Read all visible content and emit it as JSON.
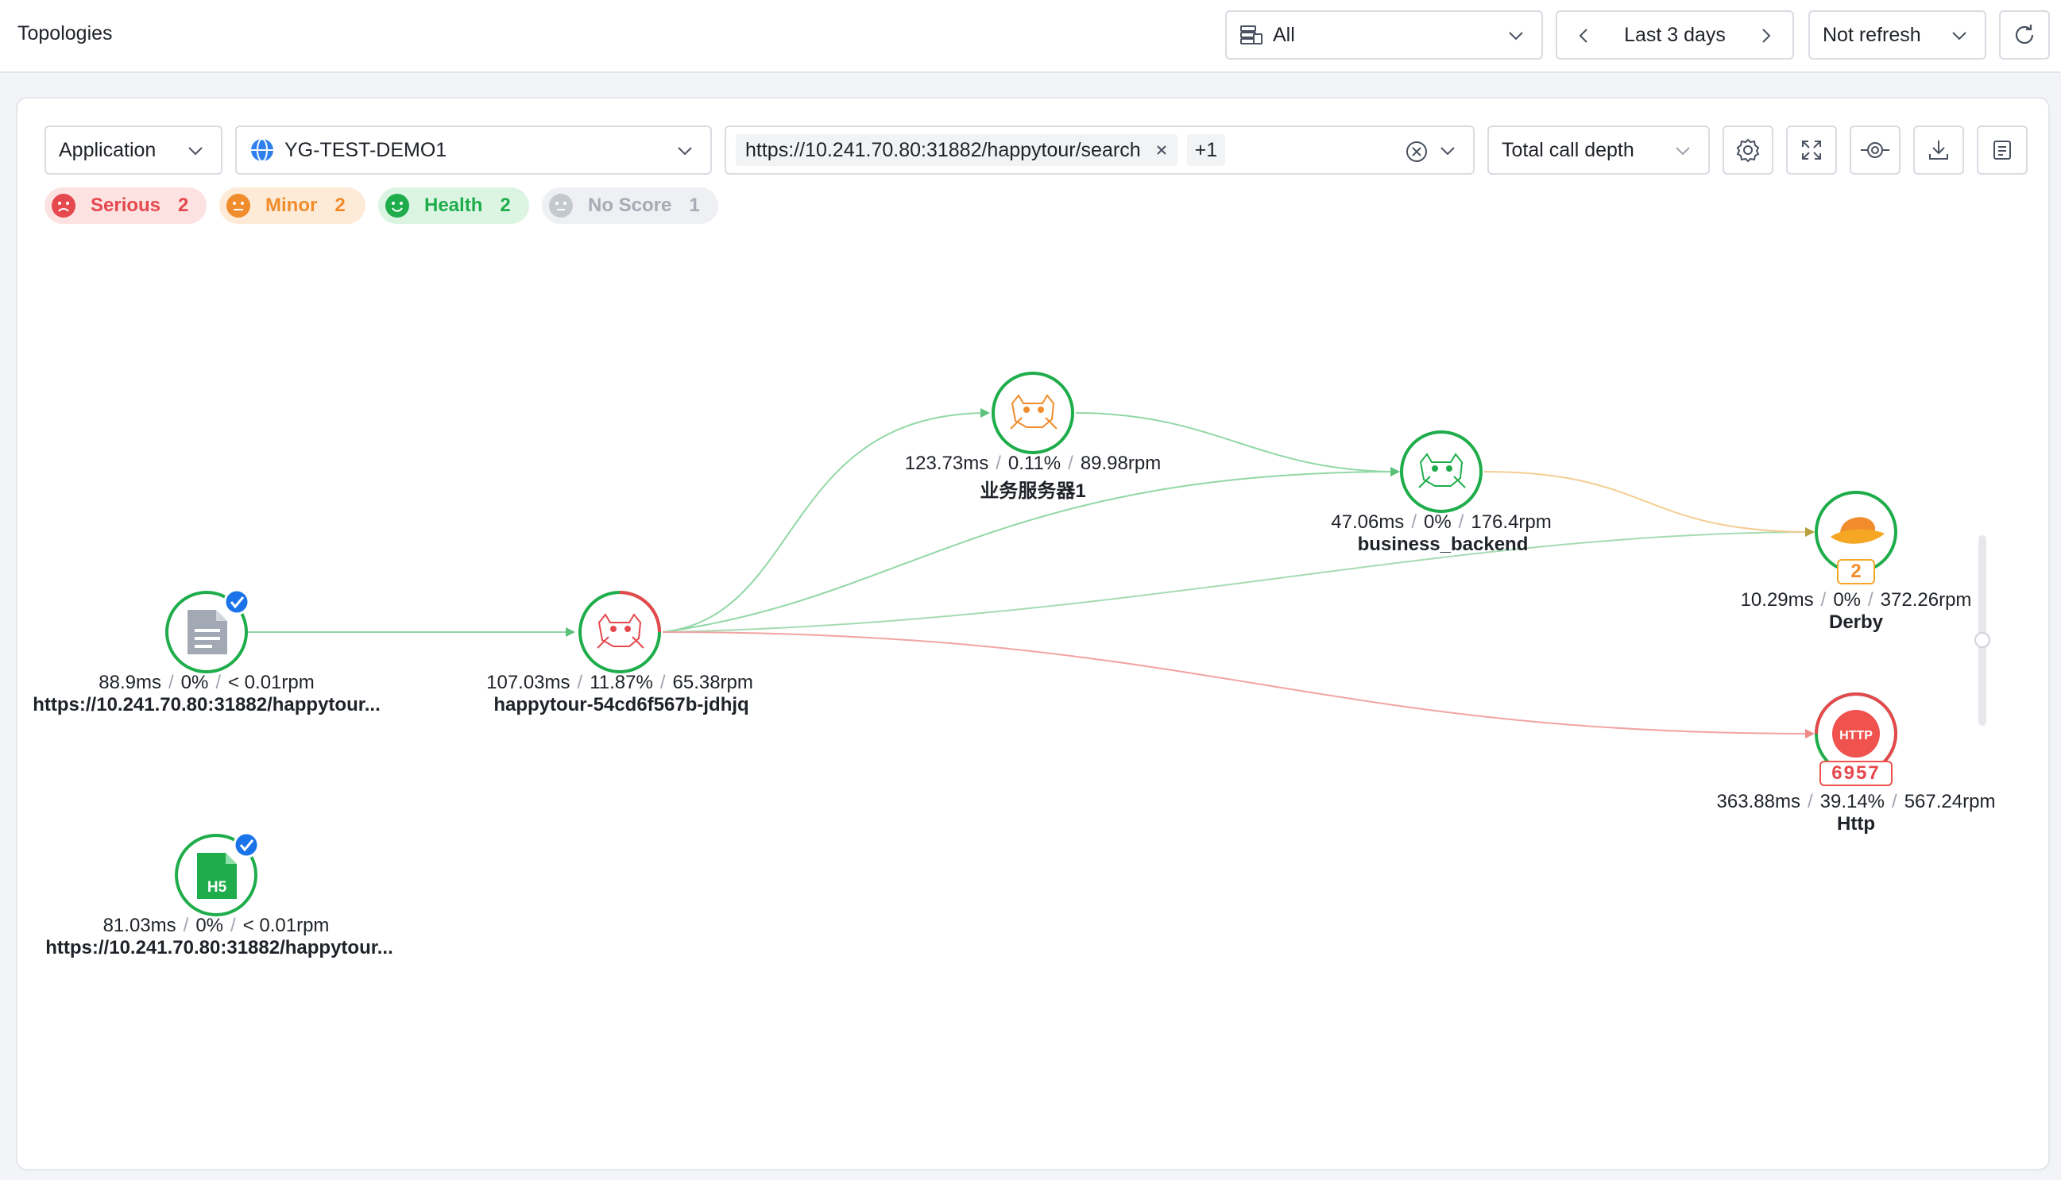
{
  "header": {
    "title": "Topologies",
    "scope_select": {
      "value": "All",
      "icon": "database-list-icon"
    },
    "time_range": {
      "value": "Last 3 days"
    },
    "refresh_select": {
      "value": "Not refresh"
    },
    "reload_icon": "reload-icon"
  },
  "toolbar": {
    "type_select": {
      "value": "Application"
    },
    "app_select": {
      "value": "YG-TEST-DEMO1",
      "icon": "globe-icon"
    },
    "url_select": {
      "tag": "https://10.241.70.80:31882/happytour/search",
      "more": "+1"
    },
    "depth_select": {
      "value": "Total call depth"
    },
    "icon_buttons": [
      "settings-icon",
      "fullscreen-icon",
      "focus-icon",
      "download-icon",
      "list-icon"
    ]
  },
  "filters": [
    {
      "label": "Serious",
      "count": "2",
      "color": "#e5484d"
    },
    {
      "label": "Minor",
      "count": "2",
      "color": "#f08c2b"
    },
    {
      "label": "Health",
      "count": "2",
      "color": "#1fad4b"
    },
    {
      "label": "No Score",
      "count": "1",
      "color": "#a6abb4"
    }
  ],
  "nodes": {
    "url_entry": {
      "latency": "88.9ms",
      "error": "0%",
      "rate": "< 0.01rpm",
      "name": "https://10.241.70.80:31882/happytour...",
      "icon": "document-icon"
    },
    "h5_entry": {
      "latency": "81.03ms",
      "error": "0%",
      "rate": "< 0.01rpm",
      "name": "https://10.241.70.80:31882/happytour...",
      "icon": "h5-icon",
      "icon_text": "H5"
    },
    "happytour": {
      "latency": "107.03ms",
      "error": "11.87%",
      "rate": "65.38rpm",
      "name": "happytour-54cd6f567b-jdhjq",
      "icon": "tomcat-icon"
    },
    "service1": {
      "latency": "123.73ms",
      "error": "0.11%",
      "rate": "89.98rpm",
      "name": "业务服务器1",
      "icon": "tomcat-icon"
    },
    "backend": {
      "latency": "47.06ms",
      "error": "0%",
      "rate": "176.4rpm",
      "name": "business_backend",
      "icon": "tomcat-icon"
    },
    "derby": {
      "latency": "10.29ms",
      "error": "0%",
      "rate": "372.26rpm",
      "name": "Derby",
      "icon": "derby-hat-icon",
      "badge": "2"
    },
    "http": {
      "latency": "363.88ms",
      "error": "39.14%",
      "rate": "567.24rpm",
      "name": "Http",
      "icon": "http-icon",
      "icon_text": "HTTP",
      "badge": "6957"
    }
  },
  "colors": {
    "healthy": "#1fad4b",
    "serious": "#e5484d",
    "minor": "#f5a623",
    "edge_green": "#92d7a6",
    "edge_red": "#f2a3a3",
    "edge_orange": "#f5cd92"
  }
}
